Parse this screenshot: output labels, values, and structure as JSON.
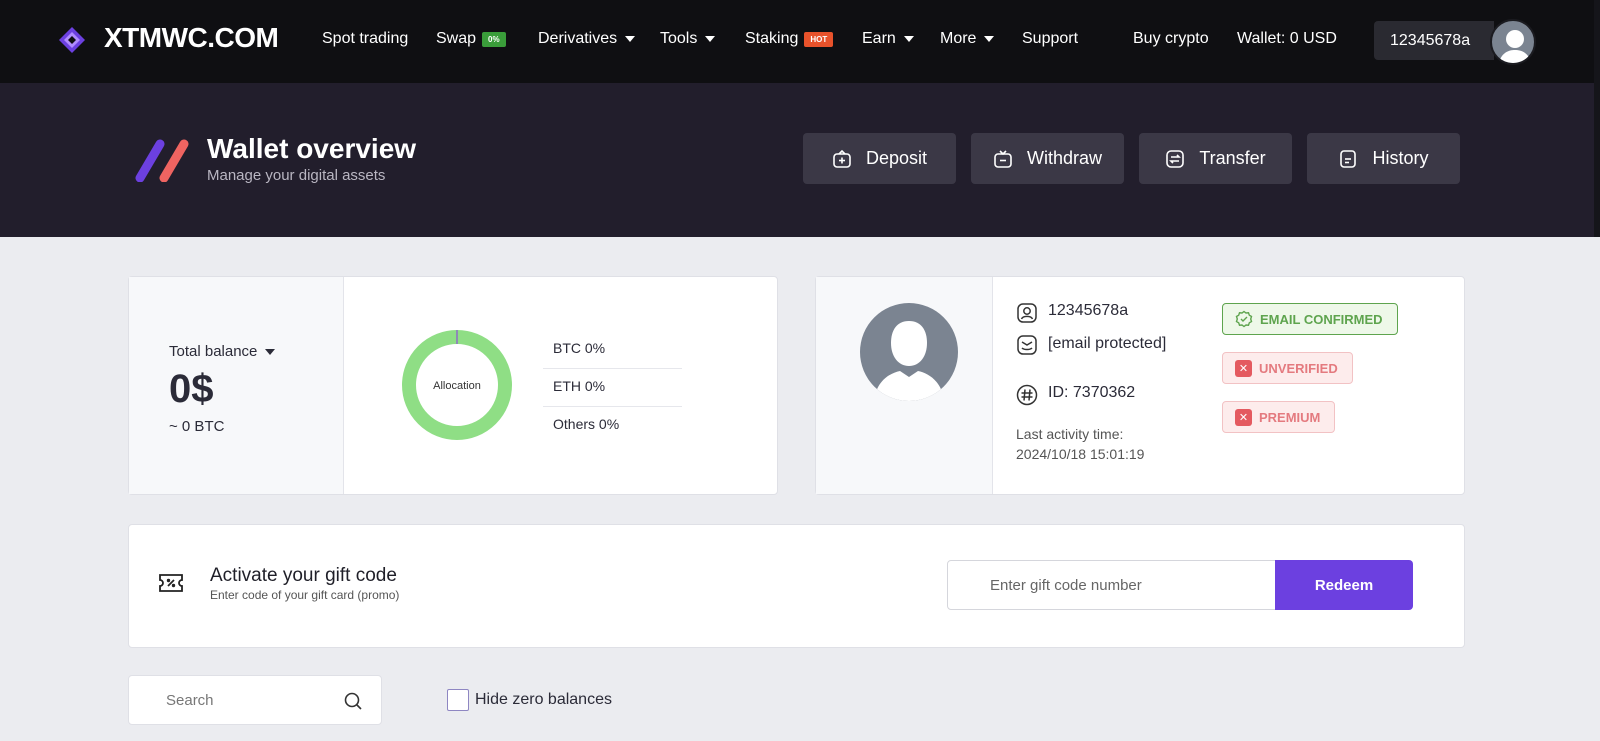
{
  "brand": {
    "name": "XTMWC.COM",
    "accent": "#6c40e0"
  },
  "nav": {
    "items": [
      {
        "label": "Spot trading"
      },
      {
        "label": "Swap",
        "badge": "0%"
      },
      {
        "label": "Derivatives"
      },
      {
        "label": "Tools"
      },
      {
        "label": "Staking",
        "badge": "HOT"
      },
      {
        "label": "Earn"
      },
      {
        "label": "More"
      },
      {
        "label": "Support"
      },
      {
        "label": "Buy crypto"
      },
      {
        "label": "Wallet: 0 USD"
      }
    ],
    "username": "12345678a"
  },
  "header": {
    "title": "Wallet overview",
    "subtitle": "Manage your digital assets",
    "buttons": [
      {
        "label": "Deposit",
        "icon": "deposit-icon"
      },
      {
        "label": "Withdraw",
        "icon": "withdraw-icon"
      },
      {
        "label": "Transfer",
        "icon": "transfer-icon"
      },
      {
        "label": "History",
        "icon": "history-icon"
      }
    ]
  },
  "balance": {
    "label": "Total balance",
    "value": "0$",
    "btc": "~ 0 BTC",
    "chart_center": "Allocation",
    "allocation": [
      {
        "label": "BTC 0%"
      },
      {
        "label": "ETH 0%"
      },
      {
        "label": "Others 0%"
      }
    ],
    "donut_color": "#8fde85"
  },
  "profile": {
    "username": "12345678a",
    "email": "[email protected]",
    "id": "ID: 7370362",
    "last_activity_label": "Last activity time:",
    "last_activity": "2024/10/18 15:01:19",
    "tags": [
      {
        "label": "EMAIL CONFIRMED",
        "status": "ok"
      },
      {
        "label": "UNVERIFIED",
        "status": "bad"
      },
      {
        "label": "PREMIUM",
        "status": "bad"
      }
    ]
  },
  "gift": {
    "title": "Activate your gift code",
    "subtitle": "Enter code of your gift card (promo)",
    "placeholder": "Enter gift code number",
    "button": "Redeem"
  },
  "filters": {
    "search_placeholder": "Search",
    "hide_zero_label": "Hide zero balances"
  }
}
